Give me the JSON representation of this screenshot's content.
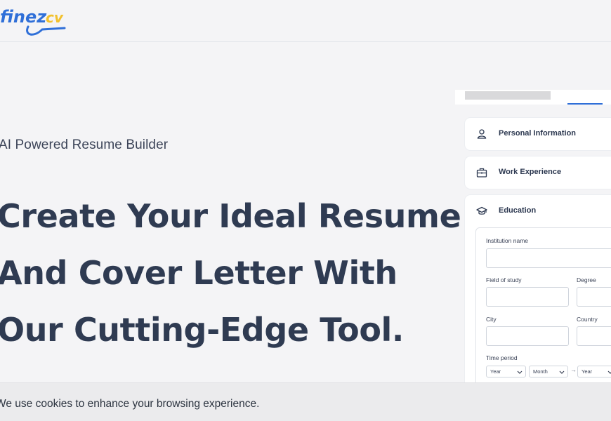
{
  "header": {
    "logo_text": "finezcv",
    "logo_icon": "finezcv-logo-icon"
  },
  "hero": {
    "eyebrow": "AI Powered Resume Builder",
    "headline_lines": [
      "Create Your Ideal Resume",
      "And Cover Letter With",
      "Our Cutting-Edge Tool."
    ]
  },
  "preview": {
    "sections": [
      {
        "title": "Personal Information",
        "icon": "user-icon"
      },
      {
        "title": "Work Experience",
        "icon": "briefcase-icon"
      },
      {
        "title": "Education",
        "icon": "graduation-cap-icon"
      }
    ],
    "education_form": {
      "institution_label": "Institution name",
      "field_label": "Field of study",
      "degree_label": "Degree",
      "city_label": "City",
      "country_label": "Country",
      "time_period_label": "Time period",
      "start_year": "Year",
      "start_month": "Month",
      "end_year": "Year"
    }
  },
  "cookie_banner": {
    "text": "We use cookies to enhance your browsing experience."
  },
  "colors": {
    "headline": "#2f3b52",
    "logo_blue": "#2f6fd8",
    "logo_yellow": "#f2c12e",
    "accent_blue": "#2f6fd8"
  }
}
